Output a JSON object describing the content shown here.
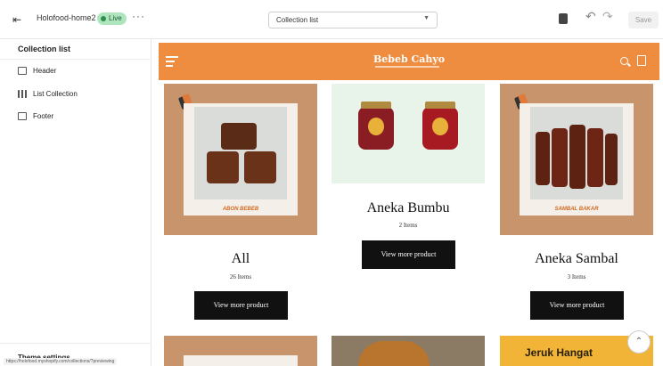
{
  "topbar": {
    "theme_name": "Holofood-home2",
    "status": "Live",
    "more": "···",
    "template_select": "Collection list",
    "save_label": "Save"
  },
  "sidebar": {
    "title": "Collection list",
    "items": [
      {
        "label": "Header"
      },
      {
        "label": "List Collection"
      },
      {
        "label": "Footer"
      }
    ],
    "theme_settings": "Theme settings"
  },
  "status_url": "https://holofood.myshopify.com/collections/?previewing",
  "store": {
    "brand": "Bebeb Cahyo"
  },
  "collections": [
    {
      "title": "All",
      "count": "26 Items",
      "button": "View more product",
      "image_label": "ABON BEBEB"
    },
    {
      "title": "Aneka Bumbu",
      "count": "2 Items",
      "button": "View more product"
    },
    {
      "title": "Aneka Sambal",
      "count": "3 Items",
      "button": "View more product",
      "image_label": "SAMBAL BAKAR"
    }
  ],
  "bottom_row": [
    {
      "title": "Jeruk Hangat"
    }
  ],
  "colors": {
    "accent": "#ee8d3f",
    "card_frame": "#c8946c",
    "button": "#111111",
    "live_badge": "#aee5bd"
  }
}
